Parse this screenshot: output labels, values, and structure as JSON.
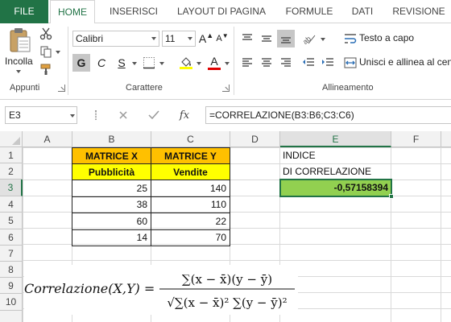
{
  "tabs": [
    "FILE",
    "HOME",
    "INSERISCI",
    "LAYOUT DI PAGINA",
    "FORMULE",
    "DATI",
    "REVISIONE"
  ],
  "ribbon": {
    "clipboard": {
      "paste_label": "Incolla",
      "group_label": "Appunti"
    },
    "font": {
      "font_name": "Calibri",
      "font_size": "11",
      "grow_label": "A",
      "shrink_label": "A",
      "bold_label": "G",
      "italic_label": "C",
      "underline_label": "S",
      "font_color_label": "A",
      "group_label": "Carattere"
    },
    "alignment": {
      "wrap_text_label": "Testo a capo",
      "merge_label": "Unisci e allinea al centro",
      "group_label": "Allineamento"
    }
  },
  "formula_bar": {
    "name_box": "E3",
    "fx_label": "fx",
    "formula": "=CORRELAZIONE(B3:B6;C3:C6)"
  },
  "columns": [
    "A",
    "B",
    "C",
    "D",
    "E",
    "F"
  ],
  "rows": [
    "1",
    "2",
    "3",
    "4",
    "5",
    "6",
    "7",
    "8",
    "9",
    "10"
  ],
  "cells": {
    "B1": "MATRICE X",
    "C1": "MATRICE Y",
    "B2": "Pubblicità",
    "C2": "Vendite",
    "B3": "25",
    "C3": "140",
    "B4": "38",
    "C4": "110",
    "B5": "60",
    "C5": "22",
    "B6": "14",
    "C6": "70",
    "E1": "INDICE",
    "E2": "DI CORRELAZIONE",
    "E3": "-0,57158394"
  },
  "formula_image": {
    "lhs": "Correlazione(X,Y) =",
    "numerator": "∑(x − x̄)(y − ȳ)",
    "denominator": "√∑(x − x̄)² ∑(y − ȳ)²"
  },
  "colors": {
    "excel_green": "#217346",
    "orange": "#ffc000",
    "yellow": "#ffff00",
    "result_green": "#92d050"
  }
}
